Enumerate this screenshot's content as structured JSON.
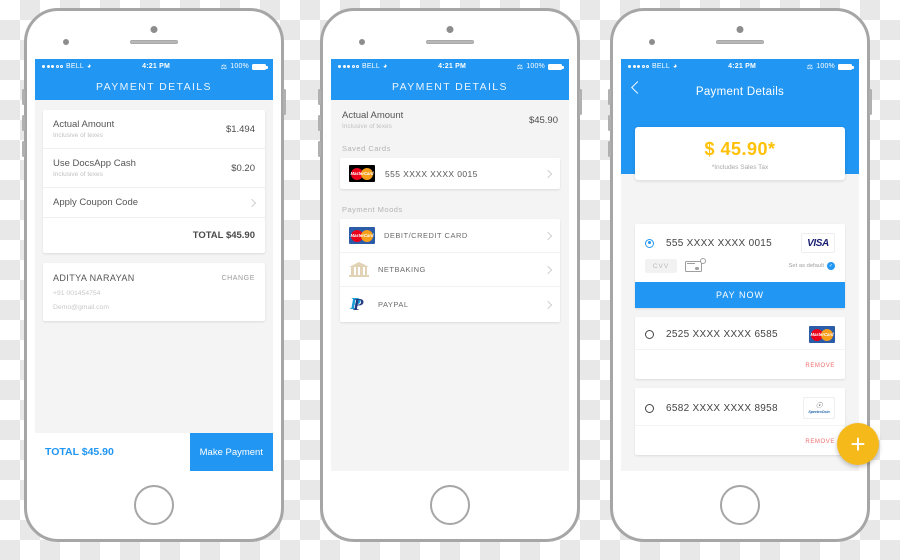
{
  "status_bar": {
    "carrier": "BELL",
    "time": "4:21 PM",
    "battery": "100%",
    "wifi_icon": "wifi-icon",
    "bluetooth_icon": "bluetooth-icon"
  },
  "phone1": {
    "header_title": "PAYMENT DETAILS",
    "summary_rows": [
      {
        "label": "Actual Amount",
        "sub": "Inclusive of texes",
        "amount": "$1.494"
      },
      {
        "label": "Use DocsApp Cash",
        "sub": "Inclusive of texes",
        "amount": "$0.20"
      }
    ],
    "coupon_label": "Apply Coupon Code",
    "total_label": "TOTAL $45.90",
    "user": {
      "name": "ADITYA NARAYAN",
      "change_label": "CHANGE",
      "phone": "+91 001454754",
      "email": "Demo@gmail.com"
    },
    "footer": {
      "total": "TOTAL $45.90",
      "button": "Make Payment"
    }
  },
  "phone2": {
    "header_title": "PAYMENT DETAILS",
    "amount_label": "Actual Amount",
    "amount_sub": "Inclusive of texes",
    "amount_value": "$45.90",
    "saved_cards_title": "Saved Cards",
    "saved_cards": [
      {
        "number": "555 XXXX XXXX 0015",
        "brand": "mastercard"
      }
    ],
    "payment_moods_title": "Payment Moods",
    "payment_moods": [
      {
        "label": "DEBIT/CREDIT CARD",
        "icon": "mastercard-icon"
      },
      {
        "label": "NETBAKING",
        "icon": "bank-icon"
      },
      {
        "label": "PAYPAL",
        "icon": "paypal-icon"
      }
    ]
  },
  "phone3": {
    "header_title": "Payment Details",
    "back_icon": "back-chevron-icon",
    "amount": "$ 45.90*",
    "amount_note": "*Includes Sales Tax",
    "selected_card": {
      "number": "555 XXXX XXXX 0015",
      "brand": "VISA",
      "cvv_placeholder": "CVV",
      "set_default_label": "Set as default",
      "pay_button": "PAY NOW"
    },
    "other_cards": [
      {
        "number": "2525 XXXX XXXX 6585",
        "brand": "mastercard",
        "remove_label": "REMOVE"
      },
      {
        "number": "6582 XXXX XXXX 8958",
        "brand": "spectrocoin",
        "remove_label": "REMOVE"
      }
    ],
    "spectrocoin_name": "SpectroCoin",
    "fab_label": "+"
  },
  "colors": {
    "accent_blue": "#2196f3",
    "amount_orange": "#ffc107",
    "fab_yellow": "#f5b919",
    "remove_red": "#f26d6d"
  }
}
